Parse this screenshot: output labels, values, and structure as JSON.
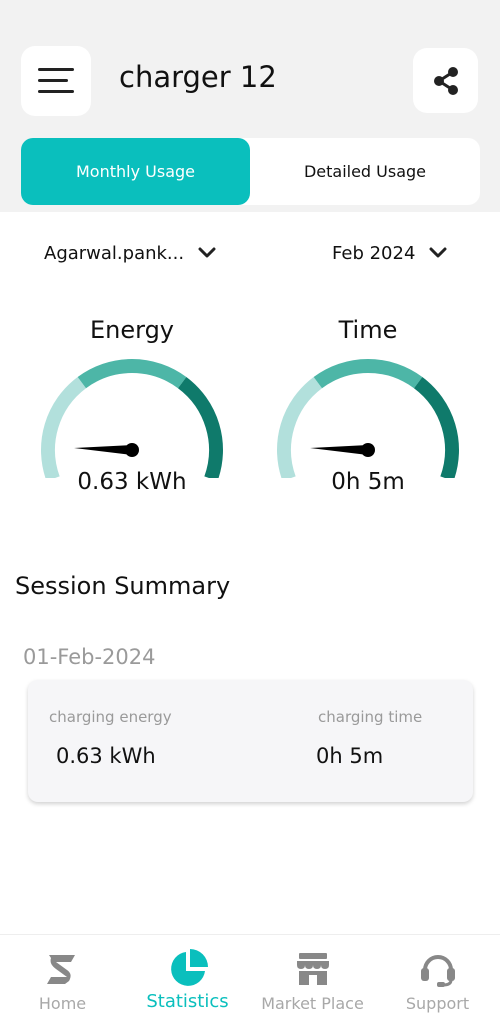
{
  "header": {
    "title": "charger 12",
    "menu_icon": "hamburger-menu-icon",
    "share_icon": "share-icon"
  },
  "tabs": [
    {
      "label": "Monthly Usage",
      "active": true
    },
    {
      "label": "Detailed Usage",
      "active": false
    }
  ],
  "filters": {
    "user": "Agarwal.pank...",
    "month": "Feb 2024"
  },
  "gauges": {
    "energy": {
      "title": "Energy",
      "value": "0.63 kWh",
      "level": 0.1
    },
    "time": {
      "title": "Time",
      "value": "0h 5m",
      "level": 0.1
    }
  },
  "colors": {
    "accent": "#0abfbd",
    "gauge_low": "#b2e0dc",
    "gauge_mid": "#4db6a7",
    "gauge_high": "#0f7a6b"
  },
  "session_summary": {
    "title": "Session Summary",
    "sessions": [
      {
        "date": "01-Feb-2024",
        "energy_label": "charging energy",
        "energy_value": "0.63 kWh",
        "time_label": "charging time",
        "time_value": "0h 5m"
      }
    ]
  },
  "bottom_nav": [
    {
      "label": "Home",
      "icon": "home-icon",
      "active": false
    },
    {
      "label": "Statistics",
      "icon": "statistics-icon",
      "active": true
    },
    {
      "label": "Market Place",
      "icon": "market-place-icon",
      "active": false
    },
    {
      "label": "Support",
      "icon": "support-icon",
      "active": false
    }
  ]
}
